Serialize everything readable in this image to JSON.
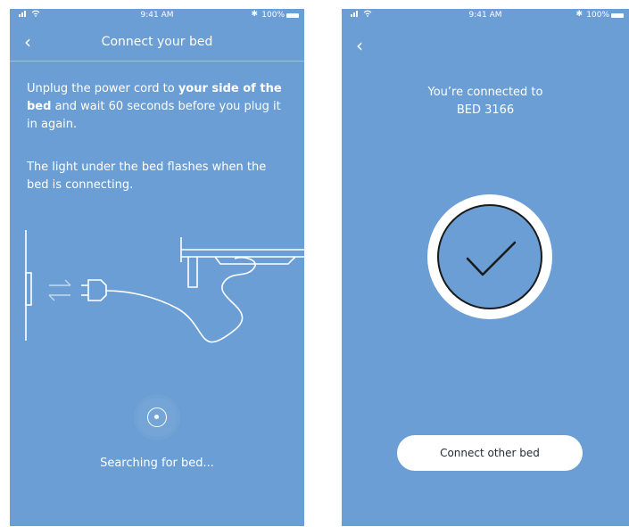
{
  "screens": {
    "left": {
      "status_bar": {
        "time": "9:41 AM",
        "battery": "100%"
      },
      "nav": {
        "back_glyph": "‹",
        "title": "Connect your bed"
      },
      "instructions": {
        "line1_part1": "Unplug the power cord to ",
        "line1_bold": "your side of the bed",
        "line1_part2": " and wait 60 seconds before you plug it in again.",
        "line2": "The light under the bed flashes when the bed is connecting."
      },
      "status_text": "Searching for bed..."
    },
    "right": {
      "status_bar": {
        "time": "9:41 AM",
        "battery": "100%"
      },
      "nav": {
        "back_glyph": "‹"
      },
      "connected_label": "You’re connected to",
      "bed_name": "BED 3166",
      "connect_other_label": "Connect other bed"
    }
  },
  "colors": {
    "screen_background": "#6a9ed4",
    "foreground": "#ffffff",
    "button_text": "#1f2a35"
  },
  "icons": [
    "signal-icon",
    "wifi-icon",
    "bluetooth-icon",
    "battery-icon",
    "back-chevron-icon",
    "plug-icon",
    "wall-socket-icon",
    "transfer-arrows-icon",
    "bed-frame-icon",
    "searching-spinner-icon",
    "checkmark-icon"
  ]
}
